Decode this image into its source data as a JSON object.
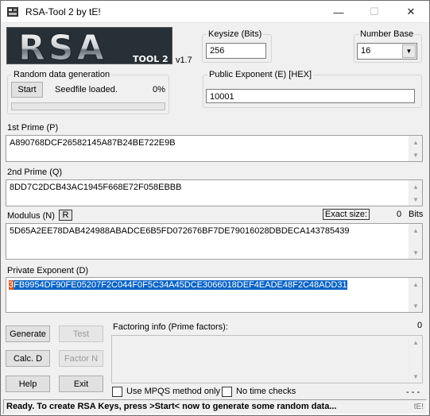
{
  "window": {
    "title": "RSA-Tool 2 by tE!",
    "minimize_glyph": "—",
    "maximize_glyph": "☐",
    "close_glyph": "✕"
  },
  "logo": {
    "text": "RSA",
    "subtext": "TOOL 2",
    "version": "v1.7"
  },
  "keysize": {
    "label": "Keysize (Bits)",
    "value": "256"
  },
  "number_base": {
    "label": "Number Base",
    "value": "16",
    "arrow": "▼"
  },
  "random": {
    "label": "Random data generation",
    "start_label": "Start",
    "status": "Seedfile loaded.",
    "percent": "0%",
    "progress": 0
  },
  "public_exponent": {
    "label": "Public Exponent (E) [HEX]",
    "value": "10001"
  },
  "prime_p": {
    "label": "1st Prime (P)",
    "value": "A890768DCF26582145A87B24BE722E9B"
  },
  "prime_q": {
    "label": "2nd Prime (Q)",
    "value": "8DD7C2DCB43AC1945F668E72F058EBBB"
  },
  "modulus": {
    "label": "Modulus (N)",
    "r_label": "R",
    "exact_size_label": "Exact size:",
    "exact_size_value": "0",
    "bits_label": "Bits",
    "value": "5D65A2EE78DAB424988ABADCE6B5FD072676BF7DE79016028DBDECA143785439"
  },
  "private_exponent": {
    "label": "Private Exponent (D)",
    "value_first": "3",
    "value_rest": "FB9954DF90FE05207F2C044F0F5C34A45DCE3066018DEF4EADE48F2C48ADD31"
  },
  "buttons": {
    "generate": "Generate",
    "test": "Test",
    "calc_d": "Calc. D",
    "factor_n": "Factor N",
    "help": "Help",
    "exit": "Exit"
  },
  "factoring": {
    "label": "Factoring info (Prime factors):",
    "count": "0"
  },
  "options": {
    "use_mpqs": "Use MPQS method only",
    "no_time_checks": "No time checks",
    "dashes": "- - -"
  },
  "status": {
    "text": "Ready. To create RSA Keys, press >Start< now to generate some random data...",
    "right": "tE!"
  },
  "scroll_glyphs": {
    "up": "▲",
    "down": "▼"
  },
  "colors": {
    "selection": "#0a64c8",
    "caret_highlight": "#e05a18",
    "logo_bg": "#1d2328"
  }
}
